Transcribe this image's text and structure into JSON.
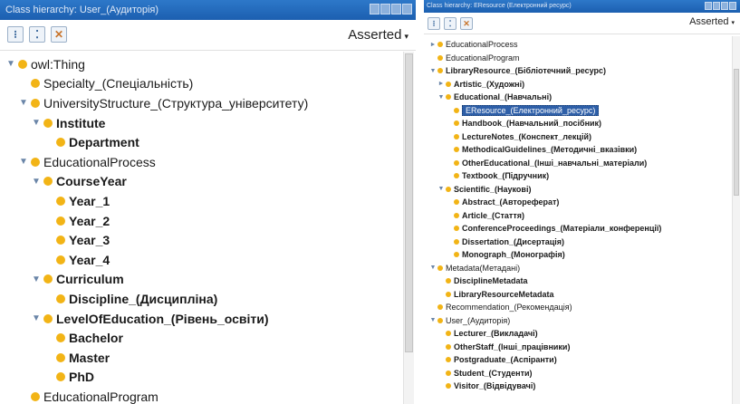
{
  "left": {
    "title": "Class hierarchy: User_(Аудиторія)",
    "view_mode": "Asserted",
    "rows": [
      {
        "label": "owl:Thing",
        "depth": 0,
        "toggle": "▼",
        "bold": false
      },
      {
        "label": "Specialty_(Спеціальність)",
        "depth": 1,
        "toggle": "",
        "bold": false
      },
      {
        "label": "UniversityStructure_(Структура_університету)",
        "depth": 1,
        "toggle": "▼",
        "bold": false
      },
      {
        "label": "Institute",
        "depth": 2,
        "toggle": "▼",
        "bold": true
      },
      {
        "label": "Department",
        "depth": 3,
        "toggle": "",
        "bold": true
      },
      {
        "label": "EducationalProcess",
        "depth": 1,
        "toggle": "▼",
        "bold": false
      },
      {
        "label": "CourseYear",
        "depth": 2,
        "toggle": "▼",
        "bold": true
      },
      {
        "label": "Year_1",
        "depth": 3,
        "toggle": "",
        "bold": true
      },
      {
        "label": "Year_2",
        "depth": 3,
        "toggle": "",
        "bold": true
      },
      {
        "label": "Year_3",
        "depth": 3,
        "toggle": "",
        "bold": true
      },
      {
        "label": "Year_4",
        "depth": 3,
        "toggle": "",
        "bold": true
      },
      {
        "label": "Curriculum",
        "depth": 2,
        "toggle": "▼",
        "bold": true
      },
      {
        "label": "Discipline_(Дисципліна)",
        "depth": 3,
        "toggle": "",
        "bold": true
      },
      {
        "label": "LevelOfEducation_(Рівень_освіти)",
        "depth": 2,
        "toggle": "▼",
        "bold": true
      },
      {
        "label": "Bachelor",
        "depth": 3,
        "toggle": "",
        "bold": true
      },
      {
        "label": "Master",
        "depth": 3,
        "toggle": "",
        "bold": true
      },
      {
        "label": "PhD",
        "depth": 3,
        "toggle": "",
        "bold": true
      },
      {
        "label": "EducationalProgram",
        "depth": 1,
        "toggle": "",
        "bold": false
      }
    ]
  },
  "right": {
    "title": "Class hierarchy: EResource (Електронний ресурс)",
    "view_mode": "Asserted",
    "rows": [
      {
        "label": "EducationalProcess",
        "depth": 0,
        "toggle": "►",
        "bold": false
      },
      {
        "label": "EducationalProgram",
        "depth": 0,
        "toggle": "",
        "bold": false
      },
      {
        "label": "LibraryResource_(Бібліотечний_ресурс)",
        "depth": 0,
        "toggle": "▼",
        "bold": true
      },
      {
        "label": "Artistic_(Художні)",
        "depth": 1,
        "toggle": "►",
        "bold": true
      },
      {
        "label": "Educational_(Навчальні)",
        "depth": 1,
        "toggle": "▼",
        "bold": true
      },
      {
        "label": "EResource_(Електронний_ресурс)",
        "depth": 2,
        "toggle": "",
        "bold": false,
        "selected": true
      },
      {
        "label": "Handbook_(Навчальний_посібник)",
        "depth": 2,
        "toggle": "",
        "bold": true
      },
      {
        "label": "LectureNotes_(Конспект_лекцій)",
        "depth": 2,
        "toggle": "",
        "bold": true
      },
      {
        "label": "MethodicalGuidelines_(Методичні_вказівки)",
        "depth": 2,
        "toggle": "",
        "bold": true
      },
      {
        "label": "OtherEducational_(Інші_навчальні_матеріали)",
        "depth": 2,
        "toggle": "",
        "bold": true
      },
      {
        "label": "Textbook_(Підручник)",
        "depth": 2,
        "toggle": "",
        "bold": true
      },
      {
        "label": "Scientific_(Наукові)",
        "depth": 1,
        "toggle": "▼",
        "bold": true
      },
      {
        "label": "Abstract_(Автореферат)",
        "depth": 2,
        "toggle": "",
        "bold": true
      },
      {
        "label": "Article_(Стаття)",
        "depth": 2,
        "toggle": "",
        "bold": true
      },
      {
        "label": "ConferenceProceedings_(Матеріали_конференції)",
        "depth": 2,
        "toggle": "",
        "bold": true
      },
      {
        "label": "Dissertation_(Дисертація)",
        "depth": 2,
        "toggle": "",
        "bold": true
      },
      {
        "label": "Monograph_(Монографія)",
        "depth": 2,
        "toggle": "",
        "bold": true
      },
      {
        "label": "Metadata(Метадані)",
        "depth": 0,
        "toggle": "▼",
        "bold": false
      },
      {
        "label": "DisciplineMetadata",
        "depth": 1,
        "toggle": "",
        "bold": true
      },
      {
        "label": "LibraryResourceMetadata",
        "depth": 1,
        "toggle": "",
        "bold": true
      },
      {
        "label": "Recommendation_(Рекомендація)",
        "depth": 0,
        "toggle": "",
        "bold": false
      },
      {
        "label": "User_(Аудиторія)",
        "depth": 0,
        "toggle": "▼",
        "bold": false
      },
      {
        "label": "Lecturer_(Викладачі)",
        "depth": 1,
        "toggle": "",
        "bold": true
      },
      {
        "label": "OtherStaff_(Інші_працівники)",
        "depth": 1,
        "toggle": "",
        "bold": true
      },
      {
        "label": "Postgraduate_(Аспіранти)",
        "depth": 1,
        "toggle": "",
        "bold": true
      },
      {
        "label": "Student_(Студенти)",
        "depth": 1,
        "toggle": "",
        "bold": true
      },
      {
        "label": "Visitor_(Відвідувачі)",
        "depth": 1,
        "toggle": "",
        "bold": true
      }
    ]
  }
}
